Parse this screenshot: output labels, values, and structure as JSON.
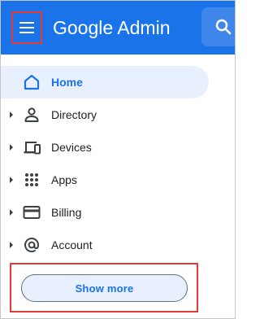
{
  "header": {
    "brand": "Google Admin",
    "menu_icon": "hamburger-menu-icon",
    "search_icon": "search-icon",
    "background": "#1a73e8"
  },
  "nav": {
    "items": [
      {
        "label": "Home",
        "icon": "home-icon",
        "active": true
      },
      {
        "label": "Directory",
        "icon": "person-icon",
        "expandable": true
      },
      {
        "label": "Devices",
        "icon": "devices-icon",
        "expandable": true
      },
      {
        "label": "Apps",
        "icon": "apps-grid-icon",
        "expandable": true
      },
      {
        "label": "Billing",
        "icon": "credit-card-icon",
        "expandable": true
      },
      {
        "label": "Account",
        "icon": "at-sign-icon",
        "expandable": true
      }
    ]
  },
  "show_more": {
    "label": "Show more"
  },
  "colors": {
    "accent": "#1a73e8",
    "highlight_outline": "#e53935",
    "active_bg": "#e8f0fe"
  }
}
